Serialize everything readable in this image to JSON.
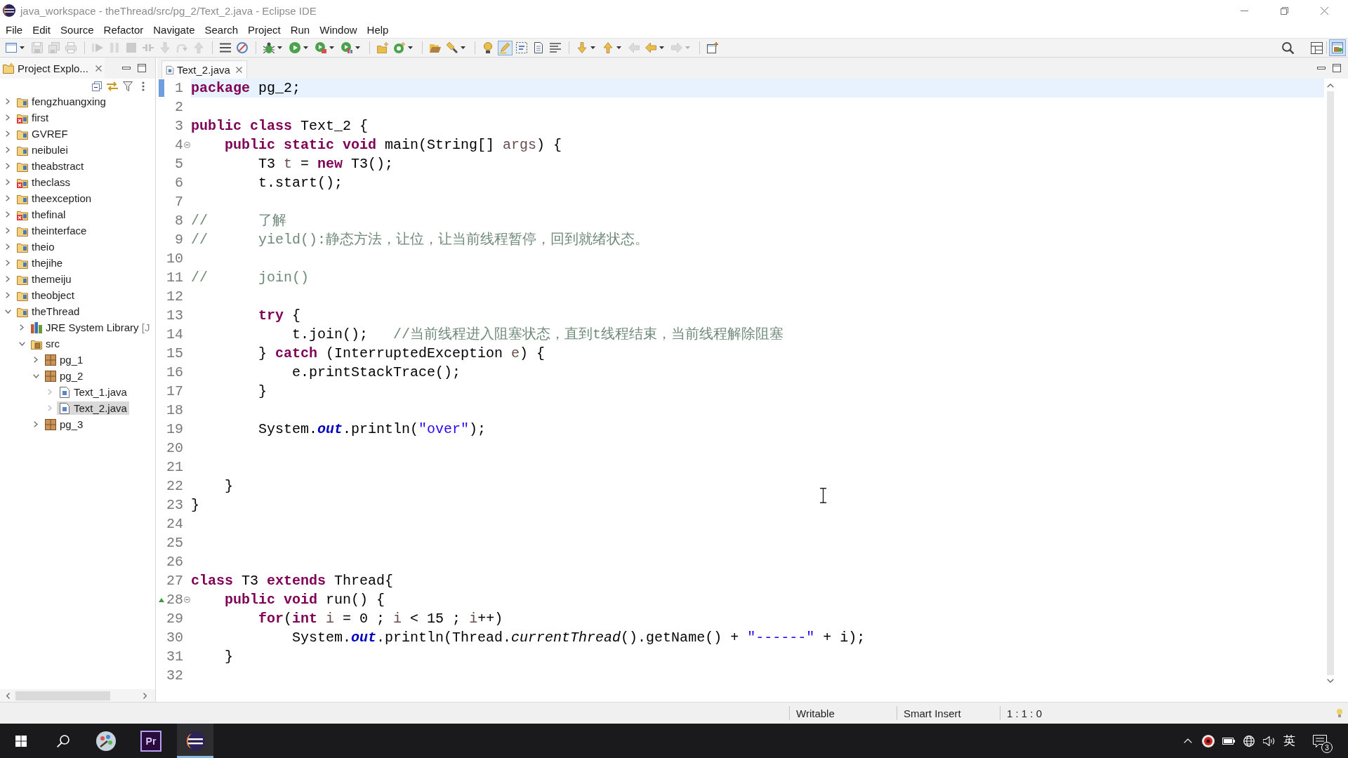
{
  "window": {
    "title": "java_workspace - theThread/src/pg_2/Text_2.java - Eclipse IDE"
  },
  "menu_bar": [
    "File",
    "Edit",
    "Source",
    "Refactor",
    "Navigate",
    "Search",
    "Project",
    "Run",
    "Window",
    "Help"
  ],
  "toolbar": {
    "groups": [
      [
        {
          "kind": "new_window",
          "menu": true,
          "disabled": false,
          "pressed": false
        },
        {
          "kind": "save",
          "menu": false,
          "disabled": true,
          "pressed": false
        },
        {
          "kind": "save_all",
          "menu": false,
          "disabled": true,
          "pressed": false
        },
        {
          "kind": "print",
          "menu": false,
          "disabled": true,
          "pressed": false
        }
      ],
      [
        {
          "kind": "resume",
          "menu": false,
          "disabled": true,
          "pressed": false
        },
        {
          "kind": "suspend",
          "menu": false,
          "disabled": true,
          "pressed": false
        },
        {
          "kind": "terminate",
          "menu": false,
          "disabled": true,
          "pressed": false
        },
        {
          "kind": "disconnect",
          "menu": false,
          "disabled": true,
          "pressed": false
        },
        {
          "kind": "step_into",
          "menu": false,
          "disabled": true,
          "pressed": false
        },
        {
          "kind": "step_over",
          "menu": false,
          "disabled": true,
          "pressed": false
        },
        {
          "kind": "step_return",
          "menu": false,
          "disabled": true,
          "pressed": false
        }
      ],
      [
        {
          "kind": "list",
          "menu": false,
          "disabled": false,
          "pressed": false
        },
        {
          "kind": "skip",
          "menu": false,
          "disabled": false,
          "pressed": false
        }
      ],
      [
        {
          "kind": "debug",
          "menu": true,
          "disabled": false,
          "pressed": false
        },
        {
          "kind": "run",
          "menu": true,
          "disabled": false,
          "pressed": false
        },
        {
          "kind": "run_tool",
          "menu": true,
          "disabled": false,
          "pressed": false
        },
        {
          "kind": "coverage",
          "menu": true,
          "disabled": false,
          "pressed": false
        }
      ],
      [
        {
          "kind": "new_project",
          "menu": false,
          "disabled": false,
          "pressed": false
        },
        {
          "kind": "new_class",
          "menu": true,
          "disabled": false,
          "pressed": false
        }
      ],
      [
        {
          "kind": "open_type",
          "menu": false,
          "disabled": false,
          "pressed": false
        },
        {
          "kind": "search",
          "menu": true,
          "disabled": false,
          "pressed": false
        }
      ],
      [
        {
          "kind": "bulb",
          "menu": false,
          "disabled": false,
          "pressed": false
        },
        {
          "kind": "highlight",
          "menu": false,
          "disabled": false,
          "pressed": true
        },
        {
          "kind": "block",
          "menu": false,
          "disabled": false,
          "pressed": false
        },
        {
          "kind": "page",
          "menu": false,
          "disabled": false,
          "pressed": false
        },
        {
          "kind": "lines",
          "menu": false,
          "disabled": false,
          "pressed": false
        }
      ],
      [
        {
          "kind": "next",
          "menu": true,
          "disabled": false,
          "pressed": false
        },
        {
          "kind": "prev",
          "menu": true,
          "disabled": false,
          "pressed": false
        },
        {
          "kind": "last_edit",
          "menu": false,
          "disabled": true,
          "pressed": false
        },
        {
          "kind": "back",
          "menu": true,
          "disabled": false,
          "pressed": false
        },
        {
          "kind": "forward",
          "menu": true,
          "disabled": true,
          "pressed": false
        }
      ],
      [
        {
          "kind": "perspective",
          "menu": false,
          "disabled": false,
          "pressed": false
        }
      ]
    ],
    "perspectives": [
      {
        "kind": "resource",
        "selected": false
      },
      {
        "kind": "java",
        "selected": true
      }
    ]
  },
  "project_explorer": {
    "tab": {
      "label": "Project Explo..."
    },
    "tree": [
      {
        "label": "fengzhuangxing",
        "kind": "project",
        "error": false,
        "expanded": false,
        "selected": false
      },
      {
        "label": "first",
        "kind": "project",
        "error": true,
        "expanded": false,
        "selected": false
      },
      {
        "label": "GVREF",
        "kind": "project",
        "error": false,
        "expanded": false,
        "selected": false
      },
      {
        "label": "neibulei",
        "kind": "project",
        "error": false,
        "expanded": false,
        "selected": false
      },
      {
        "label": "theabstract",
        "kind": "project",
        "error": false,
        "expanded": false,
        "selected": false
      },
      {
        "label": "theclass",
        "kind": "project",
        "error": true,
        "expanded": false,
        "selected": false
      },
      {
        "label": "theexception",
        "kind": "project",
        "error": false,
        "expanded": false,
        "selected": false
      },
      {
        "label": "thefinal",
        "kind": "project",
        "error": true,
        "expanded": false,
        "selected": false
      },
      {
        "label": "theinterface",
        "kind": "project",
        "error": false,
        "expanded": false,
        "selected": false
      },
      {
        "label": "theio",
        "kind": "project",
        "error": false,
        "expanded": false,
        "selected": false
      },
      {
        "label": "thejihe",
        "kind": "project",
        "error": false,
        "expanded": false,
        "selected": false
      },
      {
        "label": "themeiju",
        "kind": "project",
        "error": false,
        "expanded": false,
        "selected": false
      },
      {
        "label": "theobject",
        "kind": "project",
        "error": false,
        "expanded": false,
        "selected": false
      },
      {
        "label": "theThread",
        "kind": "project",
        "error": false,
        "expanded": true,
        "selected": false,
        "children": [
          {
            "label": "JRE System Library",
            "decoration": "[J",
            "kind": "library",
            "error": false,
            "expanded": false,
            "selected": false
          },
          {
            "label": "src",
            "kind": "source_folder",
            "error": false,
            "expanded": true,
            "selected": false,
            "children": [
              {
                "label": "pg_1",
                "kind": "package",
                "error": false,
                "expanded": false,
                "selected": false
              },
              {
                "label": "pg_2",
                "kind": "package",
                "error": false,
                "expanded": true,
                "selected": false,
                "children": [
                  {
                    "label": "Text_1.java",
                    "kind": "java_file",
                    "error": false,
                    "expanded": false,
                    "selected": false
                  },
                  {
                    "label": "Text_2.java",
                    "kind": "java_file",
                    "error": false,
                    "expanded": false,
                    "selected": true
                  }
                ]
              },
              {
                "label": "pg_3",
                "kind": "package",
                "error": false,
                "expanded": false,
                "selected": false
              }
            ]
          }
        ]
      }
    ]
  },
  "editor": {
    "tabs": [
      {
        "label": "Text_2.java",
        "selected": true
      }
    ],
    "lines": [
      {
        "number": "1",
        "current": true,
        "foldable": false,
        "override": false,
        "tokens": [
          {
            "kind": "keyword",
            "text": "package"
          },
          {
            "kind": "plain",
            "text": " pg_2;"
          }
        ]
      },
      {
        "number": "2",
        "current": false,
        "foldable": false,
        "override": false
      },
      {
        "number": "3",
        "current": false,
        "foldable": false,
        "override": false,
        "tokens": [
          {
            "kind": "keyword",
            "text": "public "
          },
          {
            "kind": "keyword",
            "text": "class"
          },
          {
            "kind": "plain",
            "text": " Text_2 {"
          }
        ]
      },
      {
        "number": "4",
        "current": false,
        "foldable": true,
        "override": false,
        "tokens": [
          {
            "kind": "keyword",
            "text": "    public "
          },
          {
            "kind": "keyword",
            "text": "static "
          },
          {
            "kind": "keyword",
            "text": "void"
          },
          {
            "kind": "plain",
            "text": " main(String[] "
          },
          {
            "kind": "variable",
            "text": "args"
          },
          {
            "kind": "plain",
            "text": ") {"
          }
        ]
      },
      {
        "number": "5",
        "current": false,
        "foldable": false,
        "override": false,
        "tokens": [
          {
            "kind": "plain",
            "text": "        T3 "
          },
          {
            "kind": "variable",
            "text": "t"
          },
          {
            "kind": "plain",
            "text": " = "
          },
          {
            "kind": "keyword",
            "text": "new"
          },
          {
            "kind": "plain",
            "text": " T3();"
          }
        ]
      },
      {
        "number": "6",
        "current": false,
        "foldable": false,
        "override": false,
        "tokens": [
          {
            "kind": "plain",
            "text": "        t.start();"
          }
        ]
      },
      {
        "number": "7",
        "current": false,
        "foldable": false,
        "override": false
      },
      {
        "number": "8",
        "current": false,
        "foldable": false,
        "override": false,
        "tokens": [
          {
            "kind": "comment",
            "text": "//      了解"
          }
        ]
      },
      {
        "number": "9",
        "current": false,
        "foldable": false,
        "override": false,
        "tokens": [
          {
            "kind": "comment",
            "text": "//      yield():静态方法，让位，让当前线程暂停，回到就绪状态。"
          }
        ]
      },
      {
        "number": "10",
        "current": false,
        "foldable": false,
        "override": false
      },
      {
        "number": "11",
        "current": false,
        "foldable": false,
        "override": false,
        "tokens": [
          {
            "kind": "comment",
            "text": "//      join()"
          }
        ]
      },
      {
        "number": "12",
        "current": false,
        "foldable": false,
        "override": false
      },
      {
        "number": "13",
        "current": false,
        "foldable": false,
        "override": false,
        "tokens": [
          {
            "kind": "keyword",
            "text": "        try"
          },
          {
            "kind": "plain",
            "text": " {"
          }
        ]
      },
      {
        "number": "14",
        "current": false,
        "foldable": false,
        "override": false,
        "tokens": [
          {
            "kind": "plain",
            "text": "            t.join();   "
          },
          {
            "kind": "comment",
            "text": "//当前线程进入阻塞状态，直到t线程结束，当前线程解除阻塞"
          }
        ]
      },
      {
        "number": "15",
        "current": false,
        "foldable": false,
        "override": false,
        "tokens": [
          {
            "kind": "plain",
            "text": "        } "
          },
          {
            "kind": "keyword",
            "text": "catch"
          },
          {
            "kind": "plain",
            "text": " (InterruptedException "
          },
          {
            "kind": "variable",
            "text": "e"
          },
          {
            "kind": "plain",
            "text": ") {"
          }
        ]
      },
      {
        "number": "16",
        "current": false,
        "foldable": false,
        "override": false,
        "tokens": [
          {
            "kind": "plain",
            "text": "            e.printStackTrace();"
          }
        ]
      },
      {
        "number": "17",
        "current": false,
        "foldable": false,
        "override": false,
        "tokens": [
          {
            "kind": "plain",
            "text": "        }"
          }
        ]
      },
      {
        "number": "18",
        "current": false,
        "foldable": false,
        "override": false
      },
      {
        "number": "19",
        "current": false,
        "foldable": false,
        "override": false,
        "tokens": [
          {
            "kind": "plain",
            "text": "        System."
          },
          {
            "kind": "field",
            "text": "out"
          },
          {
            "kind": "plain",
            "text": ".println("
          },
          {
            "kind": "string",
            "text": "\"over\""
          },
          {
            "kind": "plain",
            "text": ");"
          }
        ]
      },
      {
        "number": "20",
        "current": false,
        "foldable": false,
        "override": false
      },
      {
        "number": "21",
        "current": false,
        "foldable": false,
        "override": false
      },
      {
        "number": "22",
        "current": false,
        "foldable": false,
        "override": false,
        "tokens": [
          {
            "kind": "plain",
            "text": "    }"
          }
        ]
      },
      {
        "number": "23",
        "current": false,
        "foldable": false,
        "override": false,
        "tokens": [
          {
            "kind": "plain",
            "text": "}"
          }
        ]
      },
      {
        "number": "24",
        "current": false,
        "foldable": false,
        "override": false
      },
      {
        "number": "25",
        "current": false,
        "foldable": false,
        "override": false
      },
      {
        "number": "26",
        "current": false,
        "foldable": false,
        "override": false
      },
      {
        "number": "27",
        "current": false,
        "foldable": false,
        "override": false,
        "tokens": [
          {
            "kind": "keyword",
            "text": "class"
          },
          {
            "kind": "plain",
            "text": " T3 "
          },
          {
            "kind": "keyword",
            "text": "extends"
          },
          {
            "kind": "plain",
            "text": " Thread{"
          }
        ]
      },
      {
        "number": "28",
        "current": false,
        "foldable": true,
        "override": true,
        "tokens": [
          {
            "kind": "keyword",
            "text": "    public "
          },
          {
            "kind": "keyword",
            "text": "void"
          },
          {
            "kind": "plain",
            "text": " run() {"
          }
        ]
      },
      {
        "number": "29",
        "current": false,
        "foldable": false,
        "override": false,
        "tokens": [
          {
            "kind": "keyword",
            "text": "        for"
          },
          {
            "kind": "plain",
            "text": "("
          },
          {
            "kind": "keyword",
            "text": "int "
          },
          {
            "kind": "variable",
            "text": "i"
          },
          {
            "kind": "plain",
            "text": " = 0 ; "
          },
          {
            "kind": "variable",
            "text": "i"
          },
          {
            "kind": "plain",
            "text": " < 15 ; "
          },
          {
            "kind": "variable",
            "text": "i"
          },
          {
            "kind": "plain",
            "text": "++)"
          }
        ]
      },
      {
        "number": "30",
        "current": false,
        "foldable": false,
        "override": false,
        "tokens": [
          {
            "kind": "plain",
            "text": "            System."
          },
          {
            "kind": "field",
            "text": "out"
          },
          {
            "kind": "plain",
            "text": ".println(Thread."
          },
          {
            "kind": "static_method",
            "text": "currentThread"
          },
          {
            "kind": "plain",
            "text": "().getName() + "
          },
          {
            "kind": "string",
            "text": "\"------\""
          },
          {
            "kind": "plain",
            "text": " + i);"
          }
        ]
      },
      {
        "number": "31",
        "current": false,
        "foldable": false,
        "override": false,
        "tokens": [
          {
            "kind": "plain",
            "text": "    }"
          }
        ]
      },
      {
        "number": "32",
        "current": false,
        "foldable": false,
        "override": false
      }
    ]
  },
  "status_bar": {
    "write_mode": "Writable",
    "insert_mode": "Smart Insert",
    "position": "1 : 1 : 0"
  },
  "taskbar": {
    "apps": [
      {
        "kind": "disc",
        "active": false
      },
      {
        "kind": "letter_tile",
        "label": "Pr",
        "active": false
      },
      {
        "kind": "ide",
        "active": true
      }
    ],
    "tray": {
      "language": "英",
      "notification_count": "3"
    }
  }
}
